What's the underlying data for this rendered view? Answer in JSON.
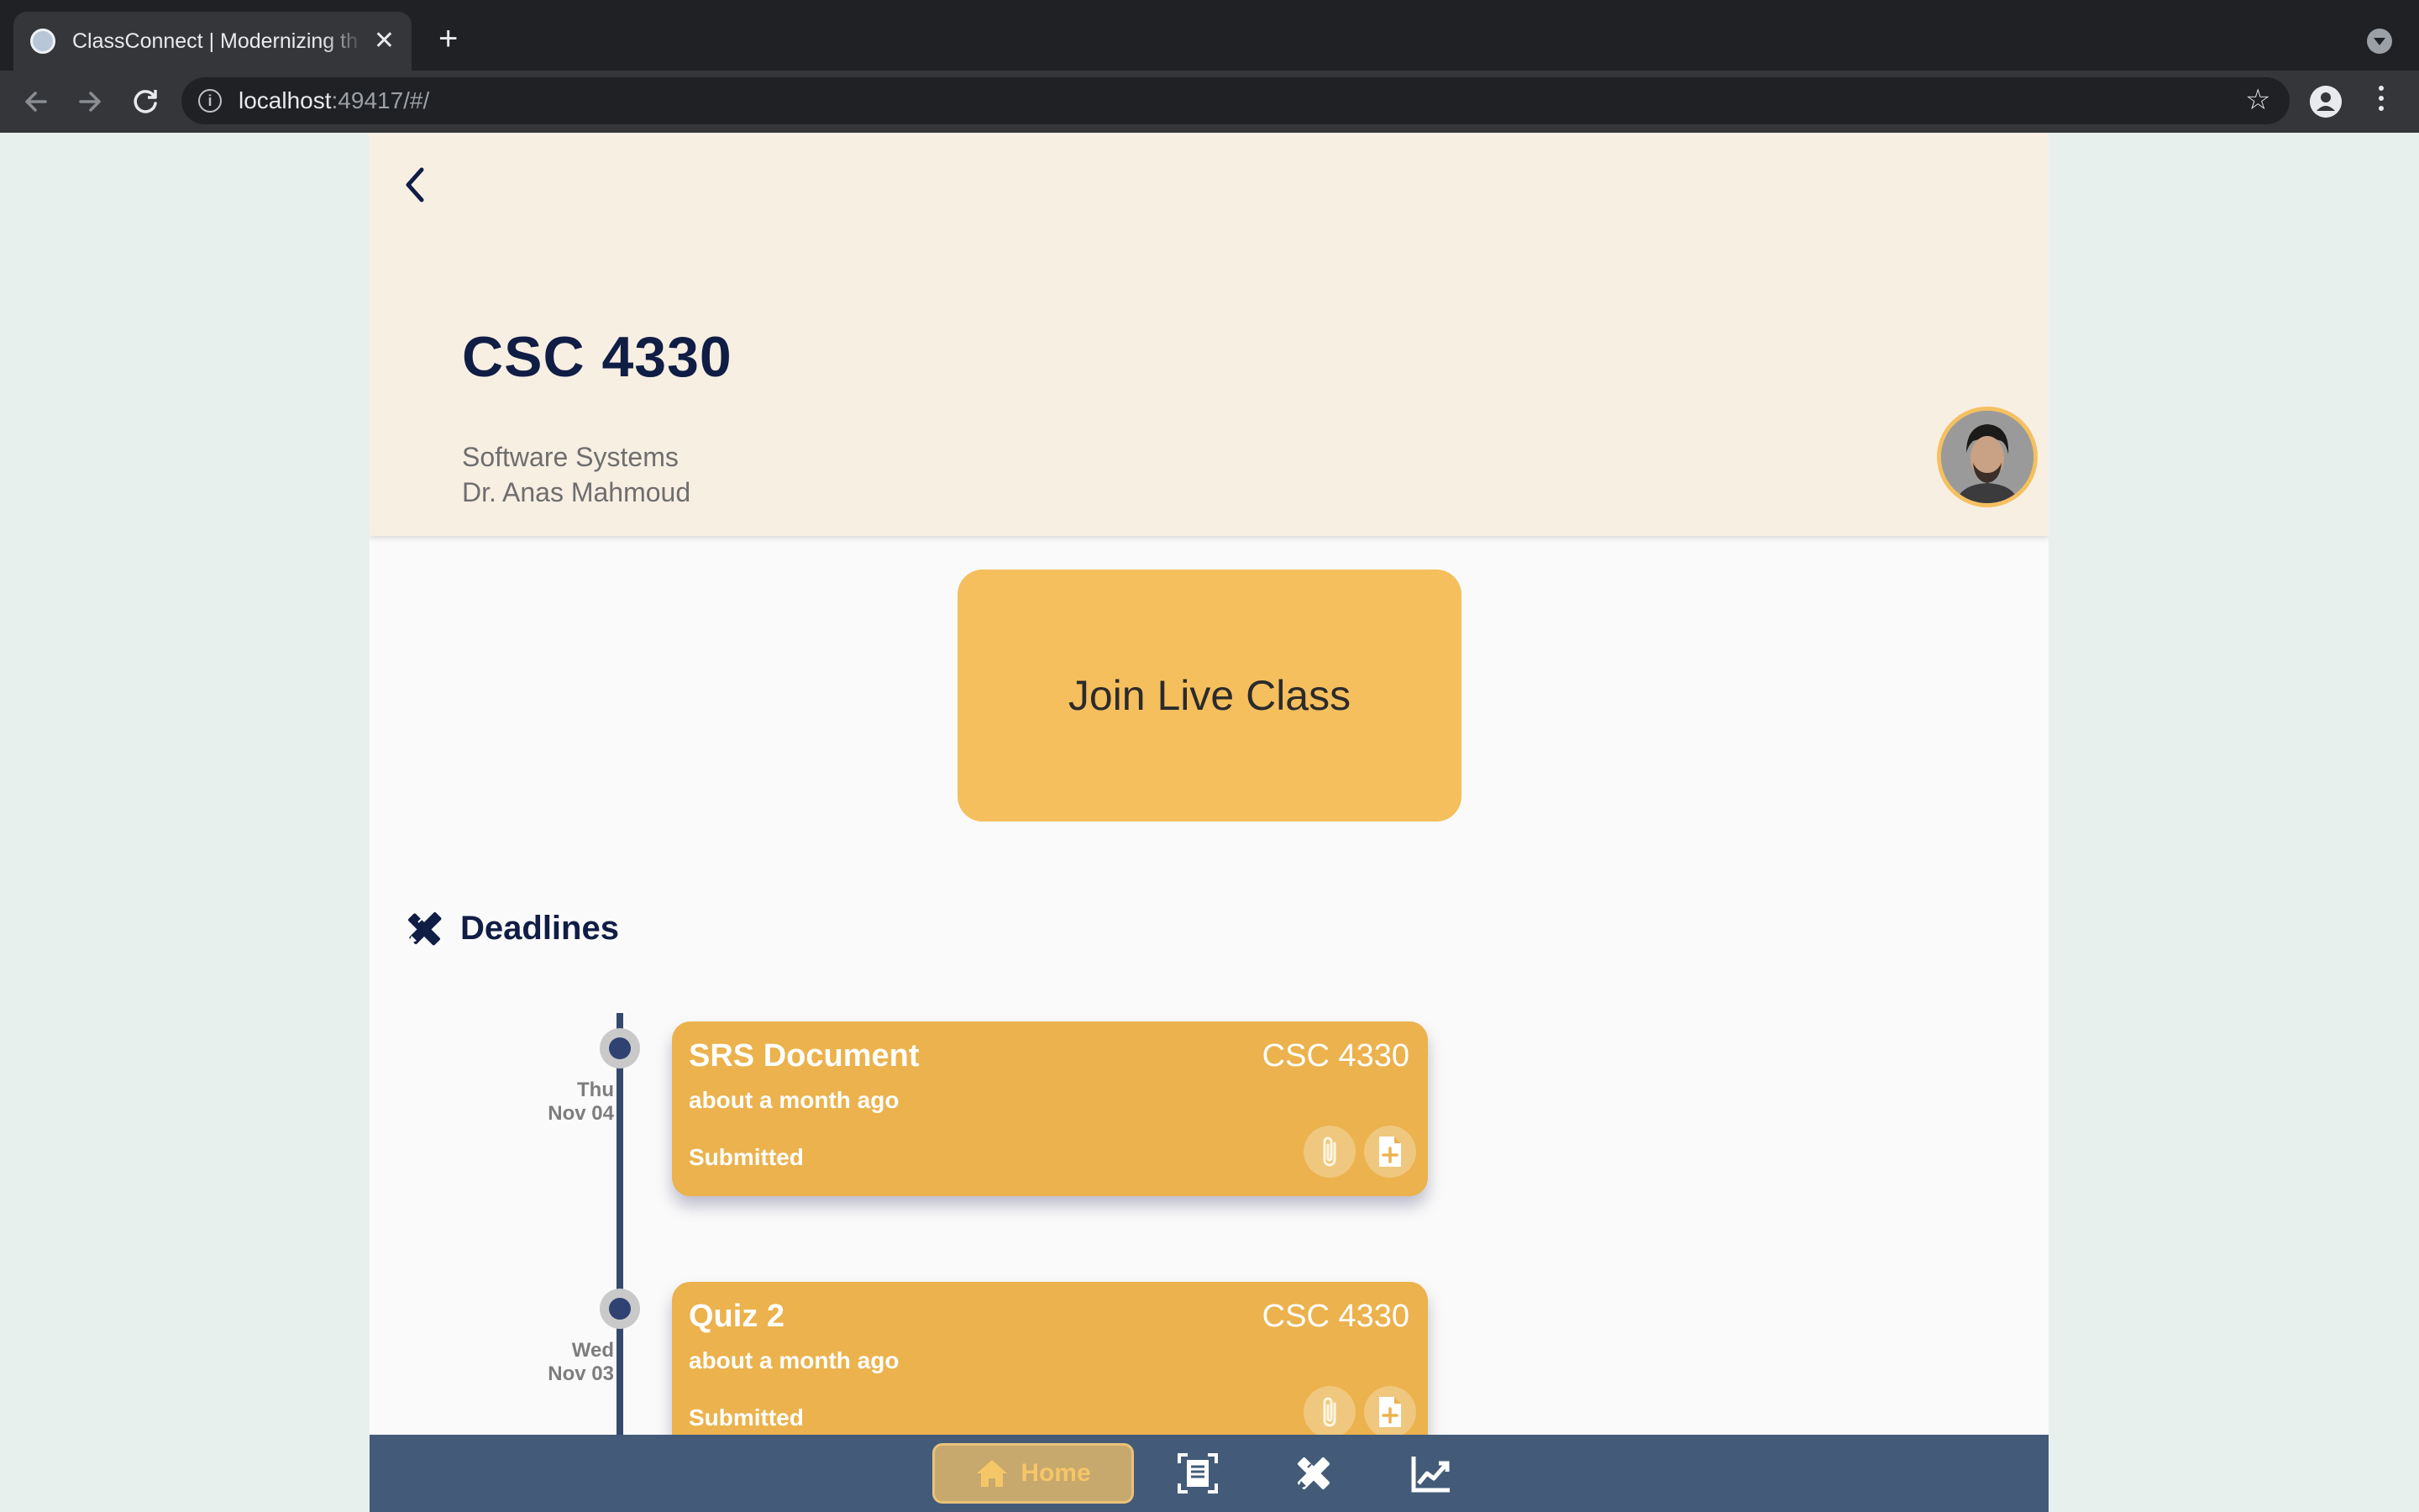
{
  "browser": {
    "tab_title": "ClassConnect | Modernizing th",
    "close_glyph": "✕",
    "new_tab_glyph": "+",
    "url_host": "localhost",
    "url_rest": ":49417/#/",
    "info_glyph": "i",
    "star_glyph": "☆"
  },
  "header": {
    "course_code": "CSC 4330",
    "course_name": "Software Systems",
    "instructor": "Dr. Anas Mahmoud"
  },
  "join_button": {
    "label": "Join Live Class"
  },
  "deadlines": {
    "title": "Deadlines",
    "items": [
      {
        "day": "Thu",
        "date": "Nov 04",
        "title": "SRS Document",
        "course": "CSC 4330",
        "when": "about a month ago",
        "status": "Submitted"
      },
      {
        "day": "Wed",
        "date": "Nov 03",
        "title": "Quiz 2",
        "course": "CSC 4330",
        "when": "about a month ago",
        "status": "Submitted"
      }
    ]
  },
  "bottom_nav": {
    "home_label": "Home",
    "icons": [
      "home-icon",
      "scan-document-icon",
      "pencil-ruler-icon",
      "chart-line-icon"
    ]
  },
  "colors": {
    "accent": "#f5bf5d",
    "card": "#ebb24d",
    "navy": "#101d45",
    "nav_bar": "#435b79"
  }
}
